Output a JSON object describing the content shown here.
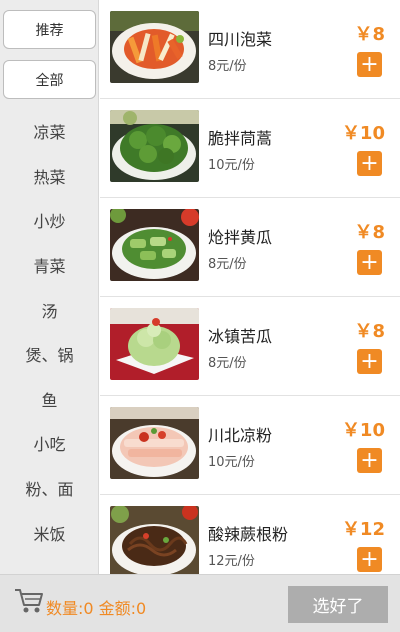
{
  "sidebar": {
    "recommend_label": "推荐",
    "all_label": "全部",
    "categories": [
      "凉菜",
      "热菜",
      "小炒",
      "青菜",
      "汤",
      "煲、锅",
      "鱼",
      "小吃",
      "粉、面",
      "米饭"
    ]
  },
  "dishes": [
    {
      "name": "四川泡菜",
      "unit": "8元/份",
      "price": "￥8"
    },
    {
      "name": "脆拌茼蒿",
      "unit": "10元/份",
      "price": "￥10"
    },
    {
      "name": "炝拌黄瓜",
      "unit": "8元/份",
      "price": "￥8"
    },
    {
      "name": "冰镇苦瓜",
      "unit": "8元/份",
      "price": "￥8"
    },
    {
      "name": "川北凉粉",
      "unit": "10元/份",
      "price": "￥10"
    },
    {
      "name": "酸辣蕨根粉",
      "unit": "12元/份",
      "price": "￥12"
    }
  ],
  "add_symbol": "+",
  "cart": {
    "summary": "数量:0 金额:0",
    "done_label": "选好了"
  },
  "colors": {
    "accent": "#f08a24",
    "sidebar_bg": "#ececec",
    "bottom_bar_bg": "#e3e3e3",
    "done_button_bg": "#adadad"
  },
  "icons": {
    "cart": "shopping-cart-icon",
    "add": "plus-icon"
  }
}
